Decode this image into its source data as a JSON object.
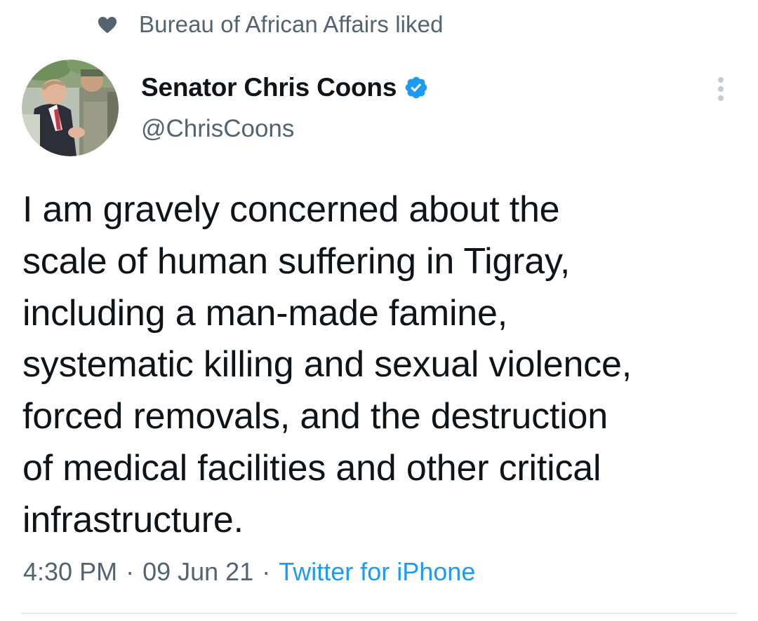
{
  "social_context": {
    "icon": "heart-icon",
    "text": "Bureau of African Affairs liked"
  },
  "author": {
    "display_name": "Senator Chris Coons",
    "handle": "@ChrisCoons",
    "verified": true,
    "verified_color": "#1d9bf0"
  },
  "tweet": {
    "text": "I am gravely concerned about the\nscale of human suffering in Tigray,\nincluding a man-made famine,\nsystematic killing and sexual violence,\nforced removals, and the destruction\nof medical facilities and other critical\ninfrastructure.",
    "time": "4:30 PM",
    "separator": "·",
    "date": "09 Jun 21",
    "source": "Twitter for iPhone"
  },
  "colors": {
    "text_primary": "#0f1419",
    "text_secondary": "#536471",
    "link": "#1d9bf0",
    "divider": "#e6e9eb"
  }
}
